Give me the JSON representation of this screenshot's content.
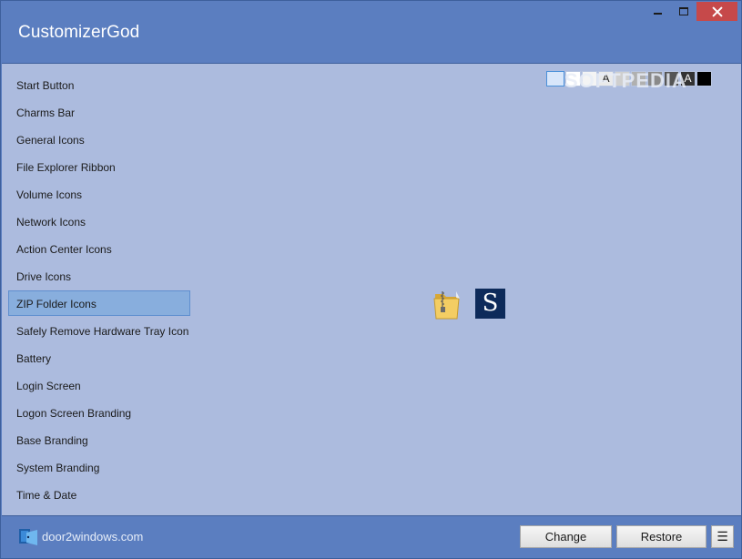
{
  "window": {
    "title": "CustomizerGod",
    "controls": {
      "minimize_icon": "minimize-icon",
      "maximize_icon": "maximize-icon",
      "close_icon": "close-icon"
    }
  },
  "nav": {
    "items": [
      {
        "label": "Start Button"
      },
      {
        "label": "Charms Bar"
      },
      {
        "label": "General Icons"
      },
      {
        "label": "File Explorer Ribbon"
      },
      {
        "label": "Volume Icons"
      },
      {
        "label": "Network Icons"
      },
      {
        "label": "Action Center Icons"
      },
      {
        "label": "Drive Icons"
      },
      {
        "label": "ZIP Folder Icons"
      },
      {
        "label": "Safely Remove Hardware Tray Icon"
      },
      {
        "label": "Battery"
      },
      {
        "label": "Login Screen"
      },
      {
        "label": "Logon Screen Branding"
      },
      {
        "label": "Base Branding"
      },
      {
        "label": "System Branding"
      },
      {
        "label": "Time & Date"
      }
    ],
    "selected_label": "ZIP Folder Icons"
  },
  "preview": {
    "swatches": [
      {
        "text": "",
        "bg": "#d8e6fa"
      },
      {
        "text": "",
        "bg": "#ffffff"
      },
      {
        "text": "",
        "bg": "#f4f4f4"
      },
      {
        "text": "A",
        "bg": "#eaeaea"
      },
      {
        "text": "",
        "bg": "#cfcfcf"
      },
      {
        "text": "",
        "bg": "#b0b0b0"
      },
      {
        "text": "",
        "bg": "#8a8a8a"
      },
      {
        "text": "",
        "bg": "#555555"
      },
      {
        "text": "A",
        "bg": "#333333"
      },
      {
        "text": "",
        "bg": "#000000"
      }
    ],
    "watermark": "SOFTPEDIA",
    "icons": [
      "zip-folder-icon",
      "s-logo-icon"
    ],
    "s_logo_text": "S"
  },
  "footer": {
    "link_text": "door2windows.com",
    "change_label": "Change",
    "restore_label": "Restore",
    "menu_label": "☰"
  },
  "colors": {
    "titlebar": "#5b7ec0",
    "content_bg": "#acbbde",
    "selected_bg": "#88aedd",
    "close_button": "#c6494a"
  }
}
